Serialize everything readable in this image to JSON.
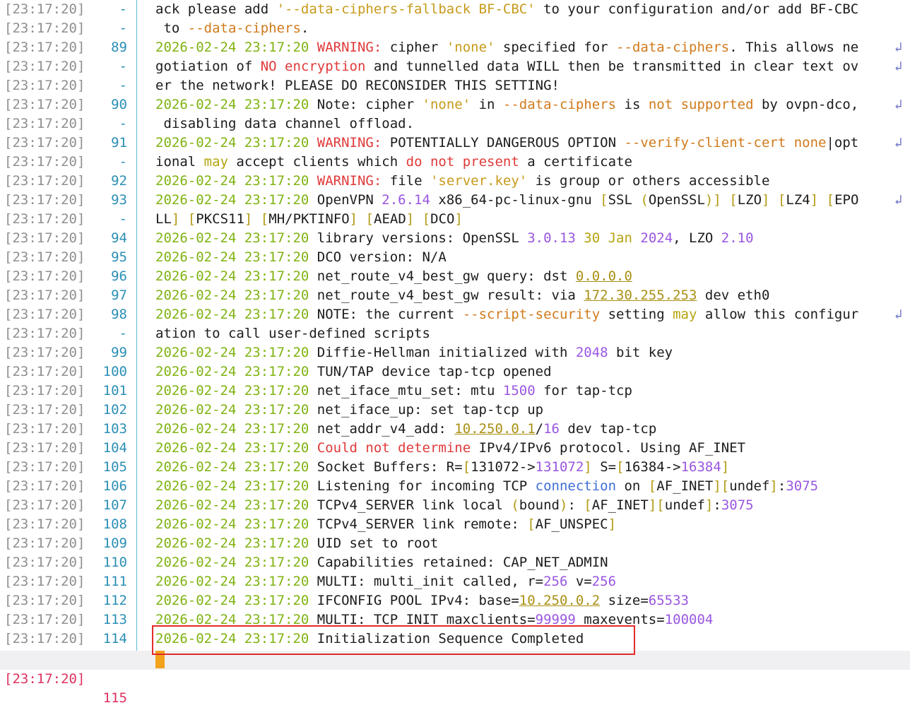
{
  "current_timestamp": "[23:17:20]",
  "current_line": "115",
  "rows": [
    {
      "ts": "[23:17:20]",
      "ln": "-",
      "wrap": false,
      "segs": [
        {
          "t": "ack please add ",
          "c": ""
        },
        {
          "t": "'--data-ciphers-fallback BF-CBC'",
          "c": "str"
        },
        {
          "t": " to your configuration and/or add BF-CBC",
          "c": ""
        }
      ]
    },
    {
      "ts": "[23:17:20]",
      "ln": "-",
      "wrap": false,
      "segs": [
        {
          "t": " to ",
          "c": ""
        },
        {
          "t": "--data-ciphers",
          "c": "opt"
        },
        {
          "t": ".",
          "c": ""
        }
      ]
    },
    {
      "ts": "[23:17:20]",
      "ln": "89",
      "wrap": true,
      "segs": [
        {
          "t": "2026-02-24 23:17:20",
          "c": "date"
        },
        {
          "t": " ",
          "c": ""
        },
        {
          "t": "WARNING:",
          "c": "warn"
        },
        {
          "t": " cipher ",
          "c": ""
        },
        {
          "t": "'none'",
          "c": "str"
        },
        {
          "t": " specified for ",
          "c": ""
        },
        {
          "t": "--data-ciphers",
          "c": "opt"
        },
        {
          "t": ". This allows ne",
          "c": ""
        }
      ]
    },
    {
      "ts": "[23:17:20]",
      "ln": "-",
      "wrap": true,
      "segs": [
        {
          "t": "gotiation of ",
          "c": ""
        },
        {
          "t": "NO encryption",
          "c": "warn"
        },
        {
          "t": " and tunnelled data WILL then be transmitted in clear text ov",
          "c": ""
        }
      ]
    },
    {
      "ts": "[23:17:20]",
      "ln": "-",
      "wrap": false,
      "segs": [
        {
          "t": "er the network! PLEASE DO RECONSIDER THIS SETTING!",
          "c": ""
        }
      ]
    },
    {
      "ts": "[23:17:20]",
      "ln": "90",
      "wrap": true,
      "segs": [
        {
          "t": "2026-02-24 23:17:20",
          "c": "date"
        },
        {
          "t": " Note: cipher ",
          "c": ""
        },
        {
          "t": "'none'",
          "c": "str"
        },
        {
          "t": " in ",
          "c": ""
        },
        {
          "t": "--data-ciphers",
          "c": "opt"
        },
        {
          "t": " is ",
          "c": ""
        },
        {
          "t": "not supported",
          "c": "opt"
        },
        {
          "t": " by ovpn-dco,",
          "c": ""
        }
      ]
    },
    {
      "ts": "[23:17:20]",
      "ln": "-",
      "wrap": false,
      "segs": [
        {
          "t": " disabling data channel offload.",
          "c": ""
        }
      ]
    },
    {
      "ts": "[23:17:20]",
      "ln": "91",
      "wrap": true,
      "segs": [
        {
          "t": "2026-02-24 23:17:20",
          "c": "date"
        },
        {
          "t": " ",
          "c": ""
        },
        {
          "t": "WARNING:",
          "c": "warn"
        },
        {
          "t": " POTENTIALLY DANGEROUS OPTION ",
          "c": ""
        },
        {
          "t": "--verify-client-cert none",
          "c": "opt"
        },
        {
          "t": "|opt",
          "c": ""
        }
      ]
    },
    {
      "ts": "[23:17:20]",
      "ln": "-",
      "wrap": false,
      "segs": [
        {
          "t": "ional ",
          "c": ""
        },
        {
          "t": "may",
          "c": "kw"
        },
        {
          "t": " accept clients which ",
          "c": ""
        },
        {
          "t": "do not present",
          "c": "warn"
        },
        {
          "t": " a certificate",
          "c": ""
        }
      ]
    },
    {
      "ts": "[23:17:20]",
      "ln": "92",
      "wrap": false,
      "segs": [
        {
          "t": "2026-02-24 23:17:20",
          "c": "date"
        },
        {
          "t": " ",
          "c": ""
        },
        {
          "t": "WARNING:",
          "c": "warn"
        },
        {
          "t": " file ",
          "c": ""
        },
        {
          "t": "'server.key'",
          "c": "str"
        },
        {
          "t": " is group or others accessible",
          "c": ""
        }
      ]
    },
    {
      "ts": "[23:17:20]",
      "ln": "93",
      "wrap": true,
      "segs": [
        {
          "t": "2026-02-24 23:17:20",
          "c": "date"
        },
        {
          "t": " OpenVPN ",
          "c": ""
        },
        {
          "t": "2.6.14",
          "c": "num"
        },
        {
          "t": " x86_64-pc-linux-gnu ",
          "c": ""
        },
        {
          "t": "[",
          "c": "dim"
        },
        {
          "t": "SSL ",
          "c": ""
        },
        {
          "t": "(",
          "c": "dim"
        },
        {
          "t": "OpenSSL",
          "c": ""
        },
        {
          "t": ")]",
          "c": "dim"
        },
        {
          "t": " ",
          "c": ""
        },
        {
          "t": "[",
          "c": "dim"
        },
        {
          "t": "LZO",
          "c": ""
        },
        {
          "t": "]",
          "c": "dim"
        },
        {
          "t": " ",
          "c": ""
        },
        {
          "t": "[",
          "c": "dim"
        },
        {
          "t": "LZ4",
          "c": ""
        },
        {
          "t": "]",
          "c": "dim"
        },
        {
          "t": " ",
          "c": ""
        },
        {
          "t": "[",
          "c": "dim"
        },
        {
          "t": "EPO",
          "c": ""
        }
      ]
    },
    {
      "ts": "[23:17:20]",
      "ln": "-",
      "wrap": false,
      "segs": [
        {
          "t": "LL",
          "c": ""
        },
        {
          "t": "]",
          "c": "dim"
        },
        {
          "t": " ",
          "c": ""
        },
        {
          "t": "[",
          "c": "dim"
        },
        {
          "t": "PKCS11",
          "c": ""
        },
        {
          "t": "]",
          "c": "dim"
        },
        {
          "t": " ",
          "c": ""
        },
        {
          "t": "[",
          "c": "dim"
        },
        {
          "t": "MH/PKTINFO",
          "c": ""
        },
        {
          "t": "]",
          "c": "dim"
        },
        {
          "t": " ",
          "c": ""
        },
        {
          "t": "[",
          "c": "dim"
        },
        {
          "t": "AEAD",
          "c": ""
        },
        {
          "t": "]",
          "c": "dim"
        },
        {
          "t": " ",
          "c": ""
        },
        {
          "t": "[",
          "c": "dim"
        },
        {
          "t": "DCO",
          "c": ""
        },
        {
          "t": "]",
          "c": "dim"
        }
      ]
    },
    {
      "ts": "[23:17:20]",
      "ln": "94",
      "wrap": false,
      "segs": [
        {
          "t": "2026-02-24 23:17:20",
          "c": "date"
        },
        {
          "t": " library versions: OpenSSL ",
          "c": ""
        },
        {
          "t": "3.0.13",
          "c": "num"
        },
        {
          "t": " ",
          "c": ""
        },
        {
          "t": "30 Jan",
          "c": "kw"
        },
        {
          "t": " ",
          "c": ""
        },
        {
          "t": "2024",
          "c": "num"
        },
        {
          "t": ", LZO ",
          "c": ""
        },
        {
          "t": "2.10",
          "c": "num"
        }
      ]
    },
    {
      "ts": "[23:17:20]",
      "ln": "95",
      "wrap": false,
      "segs": [
        {
          "t": "2026-02-24 23:17:20",
          "c": "date"
        },
        {
          "t": " DCO version: N/A",
          "c": ""
        }
      ]
    },
    {
      "ts": "[23:17:20]",
      "ln": "96",
      "wrap": false,
      "segs": [
        {
          "t": "2026-02-24 23:17:20",
          "c": "date"
        },
        {
          "t": " net_route_v4_best_gw query: dst ",
          "c": ""
        },
        {
          "t": "0.0.0.0",
          "c": "ip"
        }
      ]
    },
    {
      "ts": "[23:17:20]",
      "ln": "97",
      "wrap": false,
      "segs": [
        {
          "t": "2026-02-24 23:17:20",
          "c": "date"
        },
        {
          "t": " net_route_v4_best_gw result: via ",
          "c": ""
        },
        {
          "t": "172.30.255.253",
          "c": "ip"
        },
        {
          "t": " dev eth0",
          "c": ""
        }
      ]
    },
    {
      "ts": "[23:17:20]",
      "ln": "98",
      "wrap": true,
      "segs": [
        {
          "t": "2026-02-24 23:17:20",
          "c": "date"
        },
        {
          "t": " NOTE: the current ",
          "c": ""
        },
        {
          "t": "--script-security",
          "c": "opt"
        },
        {
          "t": " setting ",
          "c": ""
        },
        {
          "t": "may",
          "c": "kw"
        },
        {
          "t": " allow this configur",
          "c": ""
        }
      ]
    },
    {
      "ts": "[23:17:20]",
      "ln": "-",
      "wrap": false,
      "segs": [
        {
          "t": "ation to call user-defined scripts",
          "c": ""
        }
      ]
    },
    {
      "ts": "[23:17:20]",
      "ln": "99",
      "wrap": false,
      "segs": [
        {
          "t": "2026-02-24 23:17:20",
          "c": "date"
        },
        {
          "t": " Diffie-Hellman initialized with ",
          "c": ""
        },
        {
          "t": "2048",
          "c": "num"
        },
        {
          "t": " bit key",
          "c": ""
        }
      ]
    },
    {
      "ts": "[23:17:20]",
      "ln": "100",
      "wrap": false,
      "segs": [
        {
          "t": "2026-02-24 23:17:20",
          "c": "date"
        },
        {
          "t": " TUN/TAP device tap-tcp opened",
          "c": ""
        }
      ]
    },
    {
      "ts": "[23:17:20]",
      "ln": "101",
      "wrap": false,
      "segs": [
        {
          "t": "2026-02-24 23:17:20",
          "c": "date"
        },
        {
          "t": " net_iface_mtu_set: mtu ",
          "c": ""
        },
        {
          "t": "1500",
          "c": "num"
        },
        {
          "t": " for tap-tcp",
          "c": ""
        }
      ]
    },
    {
      "ts": "[23:17:20]",
      "ln": "102",
      "wrap": false,
      "segs": [
        {
          "t": "2026-02-24 23:17:20",
          "c": "date"
        },
        {
          "t": " net_iface_up: set tap-tcp up",
          "c": ""
        }
      ]
    },
    {
      "ts": "[23:17:20]",
      "ln": "103",
      "wrap": false,
      "segs": [
        {
          "t": "2026-02-24 23:17:20",
          "c": "date"
        },
        {
          "t": " net_addr_v4_add: ",
          "c": ""
        },
        {
          "t": "10.250.0.1",
          "c": "ip"
        },
        {
          "t": "/",
          "c": ""
        },
        {
          "t": "16",
          "c": "num"
        },
        {
          "t": " dev tap-tcp",
          "c": ""
        }
      ]
    },
    {
      "ts": "[23:17:20]",
      "ln": "104",
      "wrap": false,
      "segs": [
        {
          "t": "2026-02-24 23:17:20",
          "c": "date"
        },
        {
          "t": " ",
          "c": ""
        },
        {
          "t": "Could not determine",
          "c": "warn"
        },
        {
          "t": " IPv4/IPv6 protocol. Using AF_INET",
          "c": ""
        }
      ]
    },
    {
      "ts": "[23:17:20]",
      "ln": "105",
      "wrap": false,
      "segs": [
        {
          "t": "2026-02-24 23:17:20",
          "c": "date"
        },
        {
          "t": " Socket Buffers: R=",
          "c": ""
        },
        {
          "t": "[",
          "c": "dim"
        },
        {
          "t": "131072->",
          "c": ""
        },
        {
          "t": "131072",
          "c": "num"
        },
        {
          "t": "]",
          "c": "dim"
        },
        {
          "t": " S=",
          "c": ""
        },
        {
          "t": "[",
          "c": "dim"
        },
        {
          "t": "16384->",
          "c": ""
        },
        {
          "t": "16384",
          "c": "num"
        },
        {
          "t": "]",
          "c": "dim"
        }
      ]
    },
    {
      "ts": "[23:17:20]",
      "ln": "106",
      "wrap": false,
      "segs": [
        {
          "t": "2026-02-24 23:17:20",
          "c": "date"
        },
        {
          "t": " Listening for incoming TCP ",
          "c": ""
        },
        {
          "t": "connection",
          "c": "blue"
        },
        {
          "t": " on ",
          "c": ""
        },
        {
          "t": "[",
          "c": "dim"
        },
        {
          "t": "AF_INET",
          "c": ""
        },
        {
          "t": "][",
          "c": "dim"
        },
        {
          "t": "undef",
          "c": ""
        },
        {
          "t": "]",
          "c": "dim"
        },
        {
          "t": ":",
          "c": ""
        },
        {
          "t": "3075",
          "c": "num"
        }
      ]
    },
    {
      "ts": "[23:17:20]",
      "ln": "107",
      "wrap": false,
      "segs": [
        {
          "t": "2026-02-24 23:17:20",
          "c": "date"
        },
        {
          "t": " TCPv4_SERVER link local ",
          "c": ""
        },
        {
          "t": "(",
          "c": "dim"
        },
        {
          "t": "bound",
          "c": ""
        },
        {
          "t": ")",
          "c": "dim"
        },
        {
          "t": ": ",
          "c": ""
        },
        {
          "t": "[",
          "c": "dim"
        },
        {
          "t": "AF_INET",
          "c": ""
        },
        {
          "t": "][",
          "c": "dim"
        },
        {
          "t": "undef",
          "c": ""
        },
        {
          "t": "]",
          "c": "dim"
        },
        {
          "t": ":",
          "c": ""
        },
        {
          "t": "3075",
          "c": "num"
        }
      ]
    },
    {
      "ts": "[23:17:20]",
      "ln": "108",
      "wrap": false,
      "segs": [
        {
          "t": "2026-02-24 23:17:20",
          "c": "date"
        },
        {
          "t": " TCPv4_SERVER link remote: ",
          "c": ""
        },
        {
          "t": "[",
          "c": "dim"
        },
        {
          "t": "AF_UNSPEC",
          "c": ""
        },
        {
          "t": "]",
          "c": "dim"
        }
      ]
    },
    {
      "ts": "[23:17:20]",
      "ln": "109",
      "wrap": false,
      "segs": [
        {
          "t": "2026-02-24 23:17:20",
          "c": "date"
        },
        {
          "t": " UID set to root",
          "c": ""
        }
      ]
    },
    {
      "ts": "[23:17:20]",
      "ln": "110",
      "wrap": false,
      "segs": [
        {
          "t": "2026-02-24 23:17:20",
          "c": "date"
        },
        {
          "t": " Capabilities retained: CAP_NET_ADMIN",
          "c": ""
        }
      ]
    },
    {
      "ts": "[23:17:20]",
      "ln": "111",
      "wrap": false,
      "segs": [
        {
          "t": "2026-02-24 23:17:20",
          "c": "date"
        },
        {
          "t": " MULTI: multi_init called, r=",
          "c": ""
        },
        {
          "t": "256",
          "c": "num"
        },
        {
          "t": " v=",
          "c": ""
        },
        {
          "t": "256",
          "c": "num"
        }
      ]
    },
    {
      "ts": "[23:17:20]",
      "ln": "112",
      "wrap": false,
      "segs": [
        {
          "t": "2026-02-24 23:17:20",
          "c": "date"
        },
        {
          "t": " IFCONFIG POOL IPv4: base=",
          "c": ""
        },
        {
          "t": "10.250.0.2",
          "c": "ip"
        },
        {
          "t": " size=",
          "c": ""
        },
        {
          "t": "65533",
          "c": "num"
        }
      ]
    },
    {
      "ts": "[23:17:20]",
      "ln": "113",
      "wrap": false,
      "segs": [
        {
          "t": "2026-02-24 23:17:20",
          "c": "date"
        },
        {
          "t": " MULTI: TCP INIT maxclients=",
          "c": ""
        },
        {
          "t": "99999",
          "c": "num"
        },
        {
          "t": " maxevents=",
          "c": ""
        },
        {
          "t": "100004",
          "c": "num"
        }
      ]
    },
    {
      "ts": "[23:17:20]",
      "ln": "114",
      "wrap": false,
      "segs": [
        {
          "t": "2026-02-24 23:17:20",
          "c": "date"
        },
        {
          "t": " Initialization Sequence Completed",
          "c": ""
        }
      ]
    }
  ],
  "wrap_glyph": "↲",
  "colors": {
    "date": "#80b313",
    "warning": "#e03a3a",
    "string": "#c79a1a",
    "option": "#d07a1b",
    "number": "#9a56e0",
    "line_number": "#2b8fb5",
    "highlight_box": "#e32b2b",
    "cursor": "#f3a21c"
  }
}
